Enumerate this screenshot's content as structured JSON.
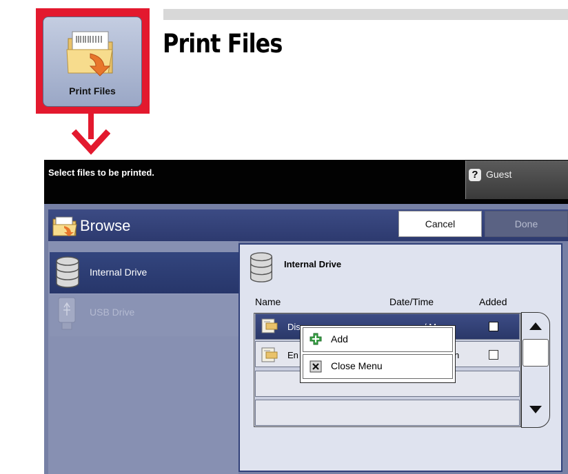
{
  "callout": {
    "app_button_label": "Print Files",
    "page_title": "Print Files",
    "frame_color": "#e3192e"
  },
  "device": {
    "message": "Select files to be printed.",
    "user_label": "Guest",
    "help_glyph": "?",
    "browse": {
      "title": "Browse",
      "cancel_label": "Cancel",
      "done_label": "Done"
    },
    "drives": [
      {
        "label": "Internal Drive",
        "icon": "database-icon",
        "selected": true
      },
      {
        "label": "USB Drive",
        "icon": "usb-drive-icon",
        "selected": false,
        "enabled": false
      }
    ],
    "panel": {
      "title": "Internal Drive",
      "columns": [
        "Name",
        "Date/Time",
        "Added"
      ],
      "rows": [
        {
          "name": "Dis",
          "date": "/ M   n",
          "added": false,
          "selected": true
        },
        {
          "name": "En",
          "date": "n",
          "added": false,
          "selected": false
        }
      ]
    },
    "context_menu": {
      "items": [
        {
          "label": "Add",
          "icon": "add-icon"
        },
        {
          "label": "Close Menu",
          "icon": "close-icon"
        }
      ]
    },
    "colors": {
      "header_blue": "#2d3a6f",
      "panel_bg": "#dfe3ef",
      "screen_bg": "#7a84a8"
    }
  }
}
